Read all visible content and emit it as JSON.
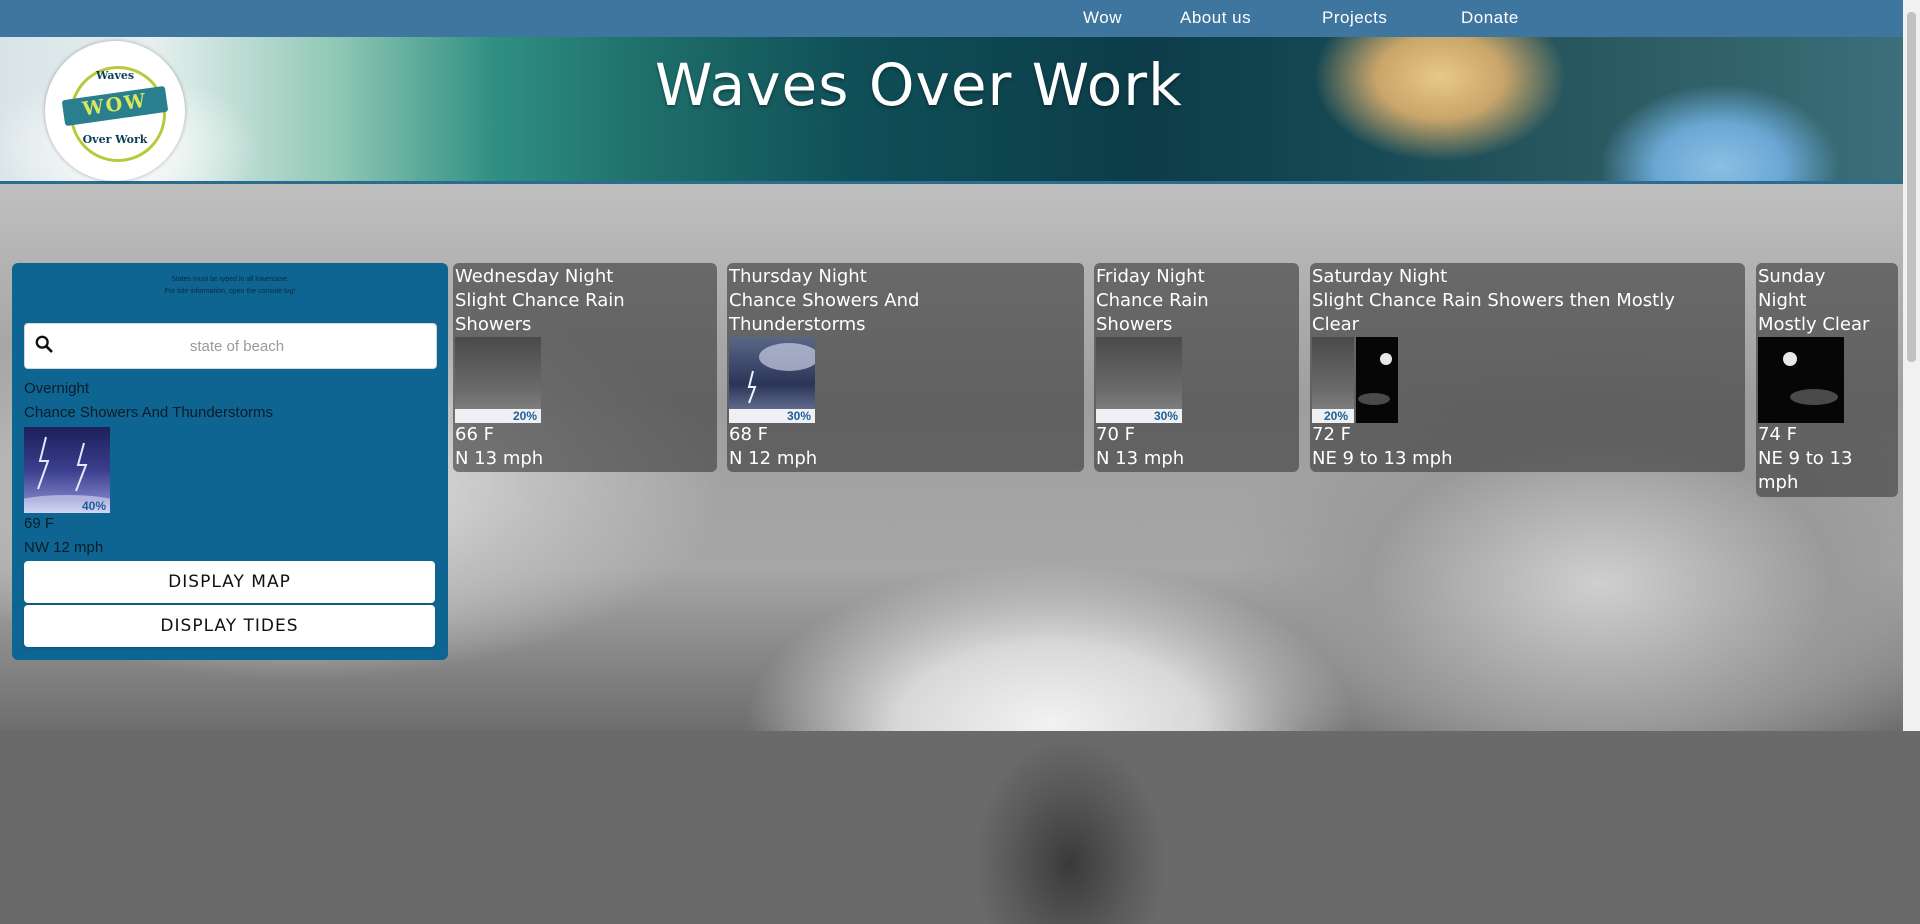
{
  "nav": {
    "links": [
      "Wow",
      "About us",
      "Projects",
      "Donate"
    ]
  },
  "banner": {
    "title": "Waves Over Work",
    "logo": {
      "top": "Waves",
      "middle": "WOW",
      "bottom": "Over Work"
    }
  },
  "search_panel": {
    "note_line1": "States must be typed in all lowercase.",
    "note_line2": "For tide information, open the console log!",
    "search_placeholder": "state of beach",
    "current": {
      "period": "Overnight",
      "forecast": "Chance Showers And Thunderstorms",
      "precip": "40%",
      "temp": "69 F",
      "wind": "NW 12 mph",
      "icon": "thunderstorm-icon"
    },
    "display_map_label": "DISPLAY MAP",
    "display_tides_label": "DISPLAY TIDES"
  },
  "cards": [
    {
      "lines": [
        "Wednesday Night",
        "Slight Chance Rain",
        "Showers"
      ],
      "precip": "20%",
      "temp": "66 F",
      "wind": "N 13 mph",
      "icon": "rain-icon"
    },
    {
      "lines": [
        "Thursday Night",
        "Chance Showers And",
        "Thunderstorms"
      ],
      "precip": "30%",
      "temp": "68 F",
      "wind": "N 12 mph",
      "icon": "thunderstorm-icon"
    },
    {
      "lines": [
        "Friday Night",
        "Chance Rain",
        "Showers"
      ],
      "precip": "30%",
      "temp": "70 F",
      "wind": "N 13 mph",
      "icon": "rain-icon"
    },
    {
      "lines": [
        "Saturday Night",
        "Slight Chance Rain Showers then Mostly",
        "Clear"
      ],
      "precip": "20%",
      "temp": "72 F",
      "wind": "NE 9 to 13 mph",
      "icon": "rain-then-clear-night-icon"
    },
    {
      "lines": [
        "Sunday",
        "Night",
        "Mostly Clear"
      ],
      "temp": "74 F",
      "wind_lines": [
        "NE 9 to 13",
        "mph"
      ],
      "icon": "clear-night-icon"
    }
  ],
  "colors": {
    "nav_bg": "#3f76a0",
    "panel_bg": "#0e6592",
    "card_bg": "rgba(60,60,60,0.62)",
    "precip_text": "#1f5f96"
  }
}
